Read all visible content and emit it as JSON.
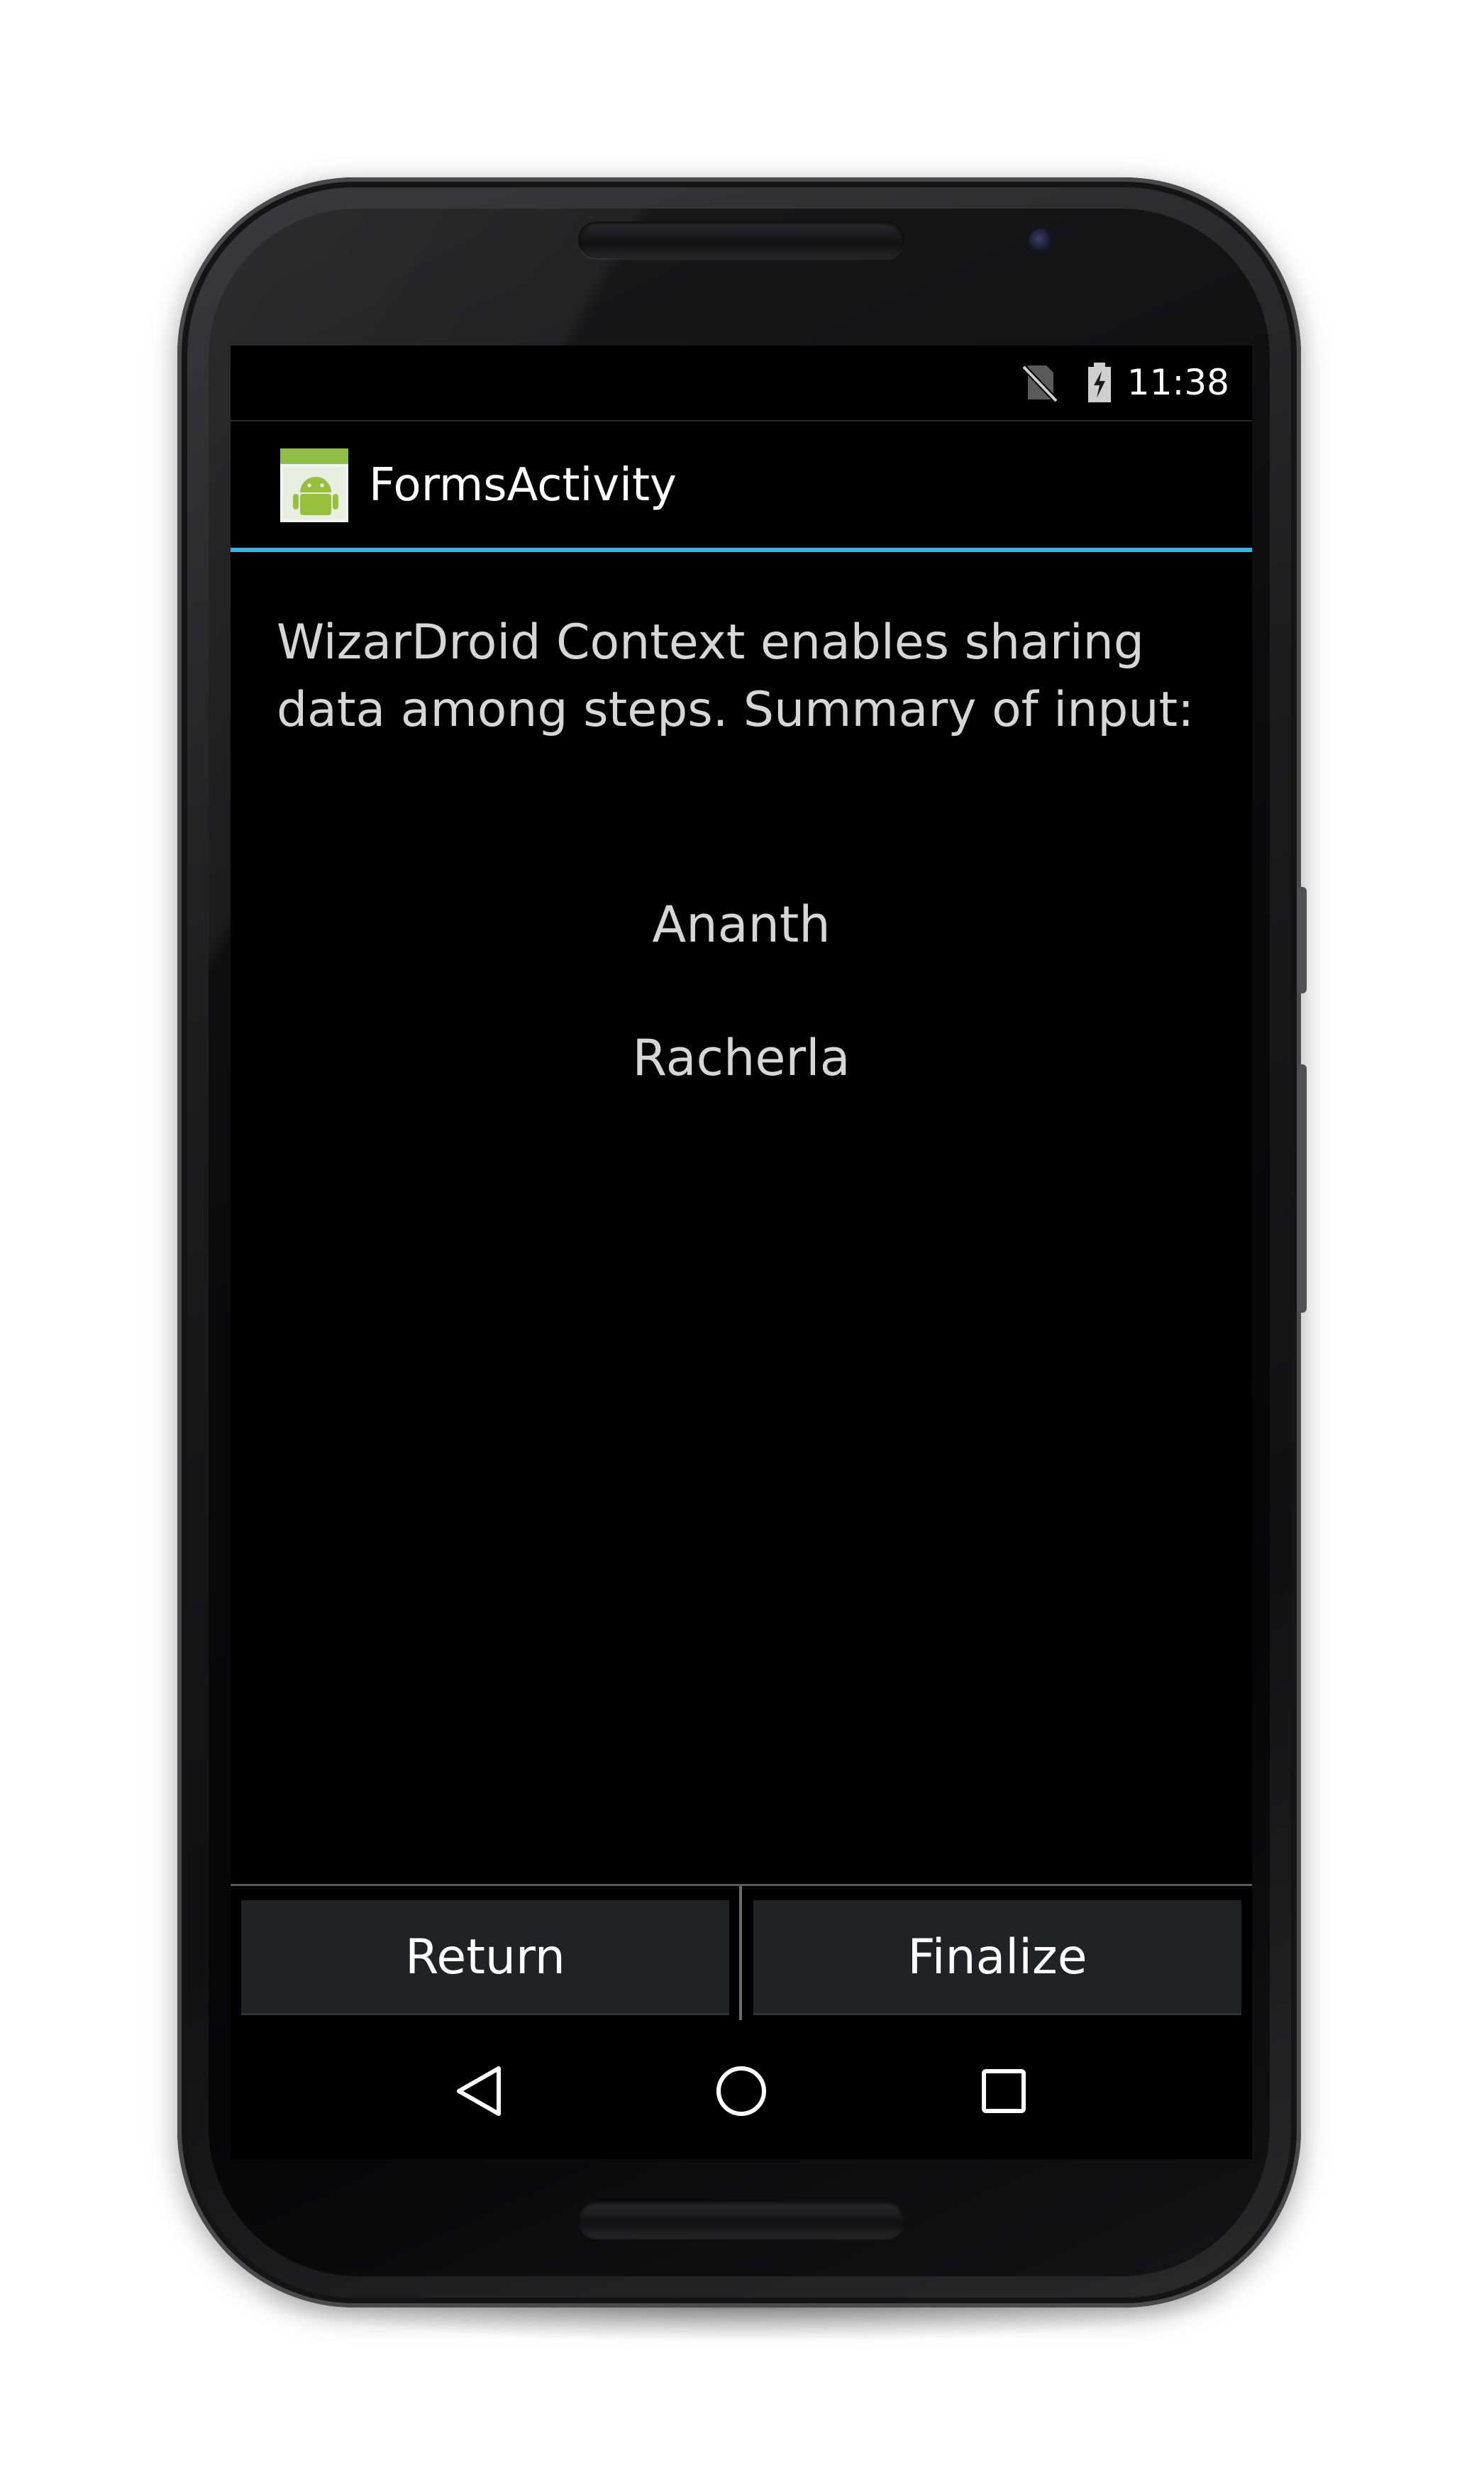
{
  "status_bar": {
    "time": "11:38",
    "icons": [
      "no-sim-icon",
      "battery-charging-icon"
    ]
  },
  "action_bar": {
    "title": "FormsActivity",
    "app_icon": "android-app-icon"
  },
  "content": {
    "description": "WizarDroid Context enables sharing data among steps. Summary of input:",
    "summary_values": [
      "Ananth",
      "Racherla"
    ]
  },
  "buttons": {
    "return_label": "Return",
    "finalize_label": "Finalize"
  },
  "nav_bar": {
    "icons": [
      "back-icon",
      "home-icon",
      "recents-icon"
    ]
  },
  "colors": {
    "accent": "#33b5e5",
    "button_bg": "#1f2326",
    "text_primary": "#ffffff",
    "text_secondary": "#d6d6d6",
    "screen_bg": "#000000"
  }
}
